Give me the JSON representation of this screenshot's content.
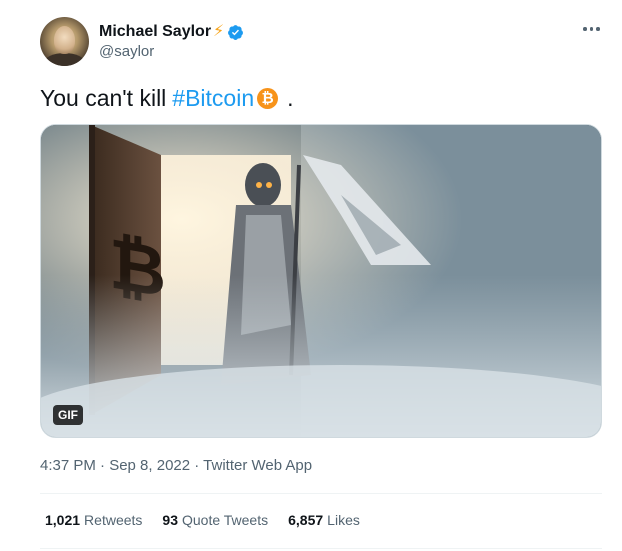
{
  "author": {
    "display_name": "Michael Saylor",
    "name_emoji": "⚡",
    "handle": "@saylor",
    "verified": true
  },
  "tweet": {
    "text_prefix": "You can't kill",
    "hashtag": "#Bitcoin",
    "btc_symbol": "₿",
    "text_suffix": ".",
    "media": {
      "type": "GIF",
      "badge": "GIF"
    }
  },
  "meta": {
    "line": "4:37 PM · Sep 8, 2022 · Twitter Web App"
  },
  "stats": {
    "retweets_count": "1,021",
    "retweets_label": "Retweets",
    "quotes_count": "93",
    "quotes_label": "Quote Tweets",
    "likes_count": "6,857",
    "likes_label": "Likes"
  },
  "icons": {
    "more": "more-horizontal-icon",
    "verified": "verified-badge-icon",
    "bitcoin": "bitcoin-icon"
  },
  "colors": {
    "link_blue": "#1d9bf0",
    "bitcoin_orange": "#f7931a",
    "secondary_text": "#536471"
  }
}
